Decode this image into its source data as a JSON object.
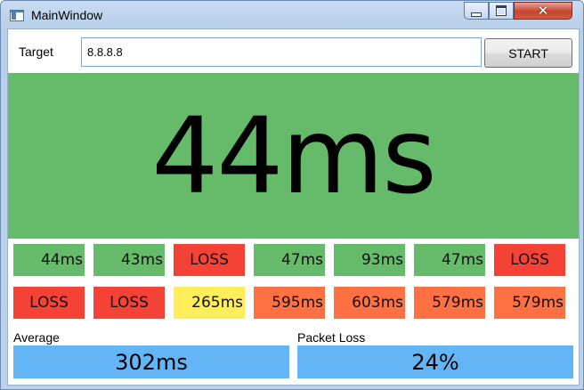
{
  "window": {
    "title": "MainWindow",
    "close_glyph": "✕"
  },
  "target": {
    "label": "Target",
    "value": "8.8.8.8"
  },
  "start_button": {
    "label": "START"
  },
  "current": {
    "value": "44ms",
    "color": "#66bb6a"
  },
  "history": [
    {
      "text": "44ms",
      "color": "#66bb6a"
    },
    {
      "text": "43ms",
      "color": "#66bb6a"
    },
    {
      "text": "LOSS",
      "color": "#f44336"
    },
    {
      "text": "47ms",
      "color": "#66bb6a"
    },
    {
      "text": "93ms",
      "color": "#66bb6a"
    },
    {
      "text": "47ms",
      "color": "#66bb6a"
    },
    {
      "text": "LOSS",
      "color": "#f44336"
    },
    {
      "text": "LOSS",
      "color": "#f44336"
    },
    {
      "text": "LOSS",
      "color": "#f44336"
    },
    {
      "text": "265ms",
      "color": "#ffee58"
    },
    {
      "text": "595ms",
      "color": "#ff7043"
    },
    {
      "text": "603ms",
      "color": "#ff7043"
    },
    {
      "text": "579ms",
      "color": "#ff7043"
    },
    {
      "text": "579ms",
      "color": "#ff7043"
    }
  ],
  "average": {
    "label": "Average",
    "value": "302ms",
    "color": "#64b5f6"
  },
  "packet_loss": {
    "label": "Packet Loss",
    "value": "24%",
    "color": "#64b5f6"
  }
}
